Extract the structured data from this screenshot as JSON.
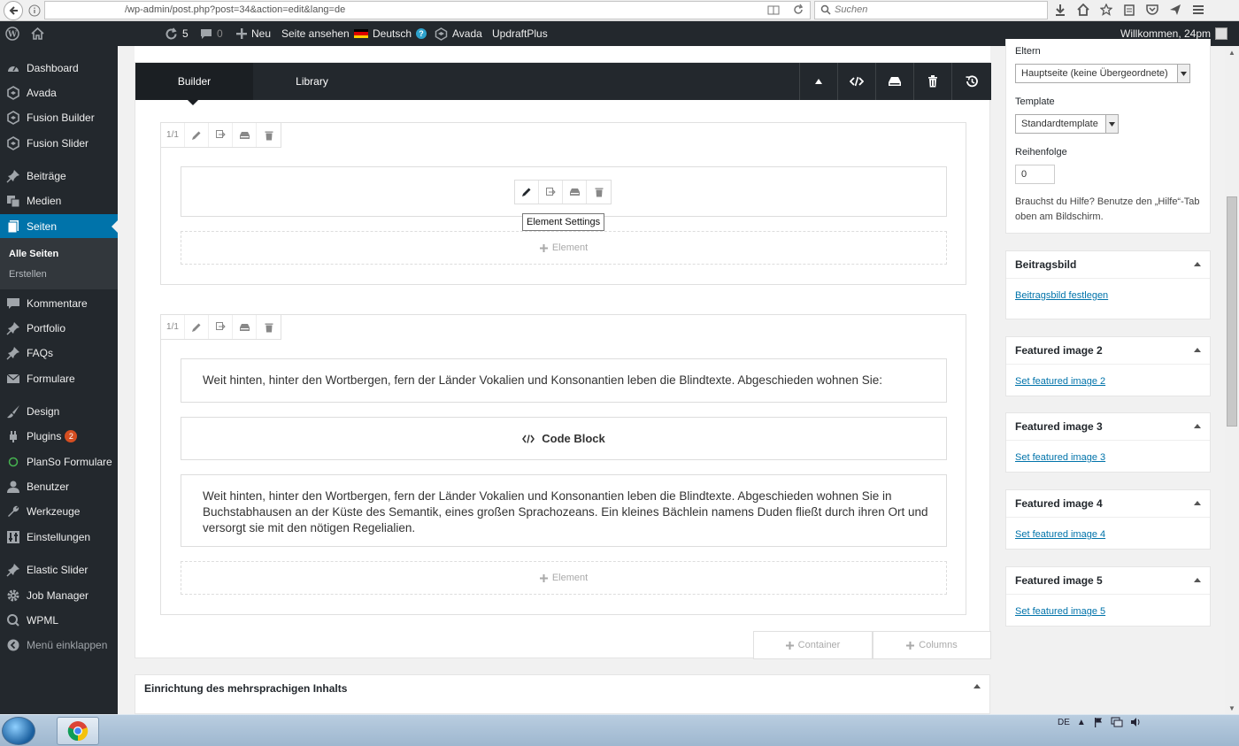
{
  "browser": {
    "url": "/wp-admin/post.php?post=34&action=edit&lang=de",
    "search_placeholder": "Suchen"
  },
  "adminbar": {
    "updates_count": "5",
    "comments_count": "0",
    "new_label": "Neu",
    "view_page_label": "Seite ansehen",
    "language_label": "Deutsch",
    "avada_label": "Avada",
    "updraft_label": "UpdraftPlus",
    "greeting": "Willkommen, 24pm"
  },
  "sidebar": {
    "items": [
      {
        "label": "Dashboard",
        "icon": "dashboard-icon"
      },
      {
        "label": "Avada",
        "icon": "avada-icon"
      },
      {
        "label": "Fusion Builder",
        "icon": "fusion-builder-icon"
      },
      {
        "label": "Fusion Slider",
        "icon": "fusion-slider-icon"
      },
      {
        "label": "Beiträge",
        "icon": "pin-icon"
      },
      {
        "label": "Medien",
        "icon": "media-icon"
      },
      {
        "label": "Seiten",
        "icon": "pages-icon"
      },
      {
        "label": "Kommentare",
        "icon": "comment-icon"
      },
      {
        "label": "Portfolio",
        "icon": "pin-icon"
      },
      {
        "label": "FAQs",
        "icon": "pin-icon"
      },
      {
        "label": "Formulare",
        "icon": "mail-icon"
      },
      {
        "label": "Design",
        "icon": "brush-icon"
      },
      {
        "label": "Plugins",
        "icon": "plugin-icon",
        "badge": "2"
      },
      {
        "label": "PlanSo Formulare",
        "icon": "circle-icon"
      },
      {
        "label": "Benutzer",
        "icon": "user-icon"
      },
      {
        "label": "Werkzeuge",
        "icon": "wrench-icon"
      },
      {
        "label": "Einstellungen",
        "icon": "settings-icon"
      },
      {
        "label": "Elastic Slider",
        "icon": "pin-icon"
      },
      {
        "label": "Job Manager",
        "icon": "gear-icon"
      },
      {
        "label": "WPML",
        "icon": "wpml-icon"
      },
      {
        "label": "Menü einklappen",
        "icon": "collapse-icon"
      }
    ],
    "submenu": {
      "all_pages": "Alle Seiten",
      "create": "Erstellen"
    }
  },
  "builder": {
    "tabs": [
      "Builder",
      "Library"
    ],
    "container1": {
      "column_size": "1/1",
      "tooltip": "Element Settings",
      "add_element": "Element"
    },
    "container2": {
      "column_size": "1/1",
      "text1": "Weit hinten, hinter den Wortbergen, fern der Länder Vokalien und Konsonantien leben die Blindtexte. Abgeschieden wohnen Sie:",
      "code_block": "Code Block",
      "text2": "Weit hinten, hinter den Wortbergen, fern der Länder Vokalien und Konsonantien leben die Blindtexte. Abgeschieden wohnen Sie in Buchstabhausen an der Küste des Semantik, eines großen Sprachozeans. Ein kleines Bächlein namens Duden fließt durch ihren Ort und versorgt sie mit den nötigen Regelialien.",
      "add_element": "Element"
    },
    "add_container": "Container",
    "add_columns": "Columns"
  },
  "multilingual": {
    "title": "Einrichtung des mehrsprachigen Inhalts"
  },
  "attributes": {
    "parent_label": "Eltern",
    "parent_value": "Hauptseite (keine Übergeordnete)",
    "template_label": "Template",
    "template_value": "Standardtemplate",
    "order_label": "Reihenfolge",
    "order_value": "0",
    "help_text": "Brauchst du Hilfe? Benutze den „Hilfe“-Tab oben am Bildschirm."
  },
  "featured": [
    {
      "title": "Beitragsbild",
      "link": "Beitragsbild festlegen"
    },
    {
      "title": "Featured image 2",
      "link": "Set featured image 2"
    },
    {
      "title": "Featured image 3",
      "link": "Set featured image 3"
    },
    {
      "title": "Featured image 4",
      "link": "Set featured image 4"
    },
    {
      "title": "Featured image 5",
      "link": "Set featured image 5"
    }
  ],
  "taskbar": {
    "language": "DE"
  },
  "colors": {
    "admin_dark": "#23282d",
    "active_blue": "#0073aa",
    "badge_orange": "#d54e21"
  }
}
